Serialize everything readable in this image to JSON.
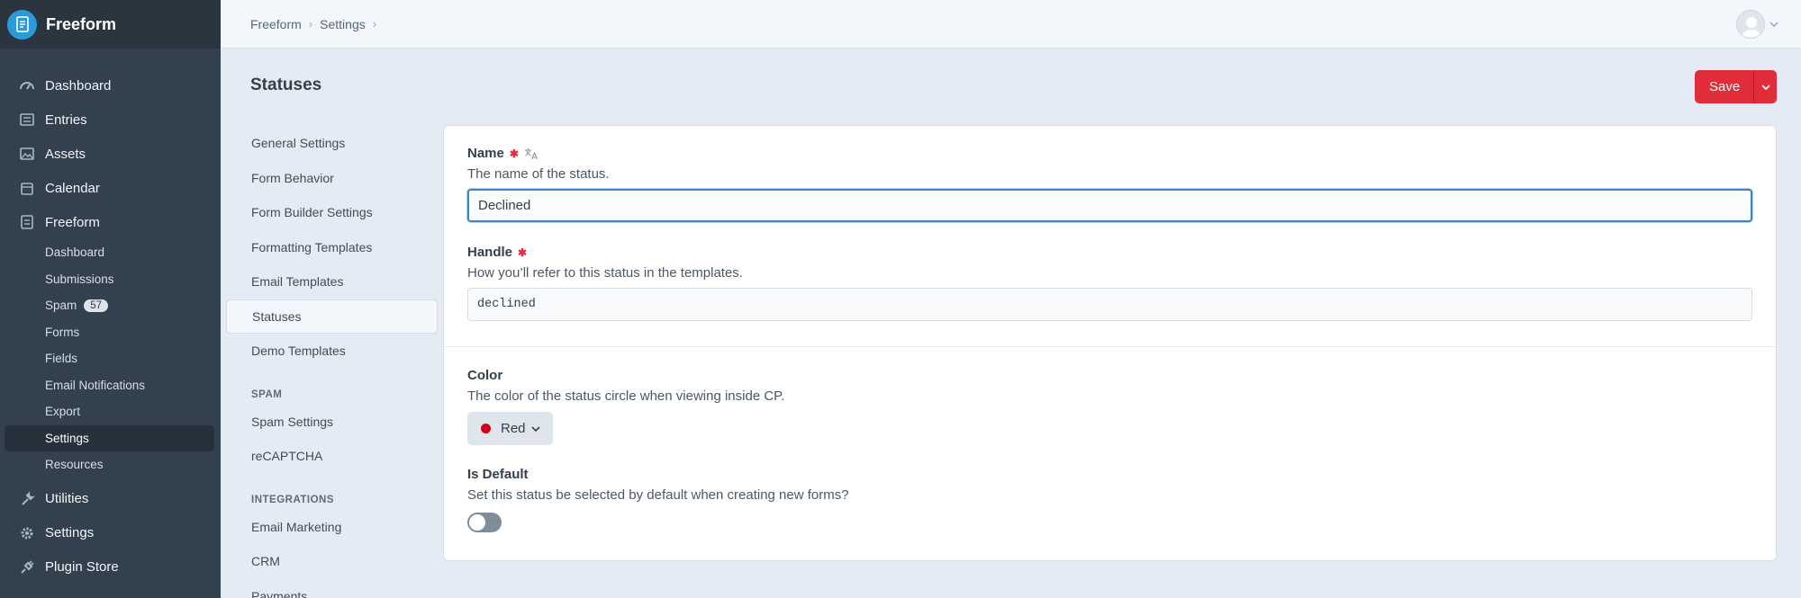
{
  "brand": {
    "name": "Freeform"
  },
  "sidebar": {
    "items": [
      {
        "label": "Dashboard",
        "icon": "dashboard-icon"
      },
      {
        "label": "Entries",
        "icon": "entries-icon"
      },
      {
        "label": "Assets",
        "icon": "assets-icon"
      },
      {
        "label": "Calendar",
        "icon": "calendar-icon"
      },
      {
        "label": "Freeform",
        "icon": "freeform-icon"
      }
    ],
    "sub_items": [
      {
        "label": "Dashboard"
      },
      {
        "label": "Submissions"
      },
      {
        "label": "Spam",
        "badge": "57"
      },
      {
        "label": "Forms"
      },
      {
        "label": "Fields"
      },
      {
        "label": "Email Notifications"
      },
      {
        "label": "Export"
      },
      {
        "label": "Settings",
        "active": true
      },
      {
        "label": "Resources"
      }
    ],
    "bottom_items": [
      {
        "label": "Utilities",
        "icon": "wrench-icon"
      },
      {
        "label": "Settings",
        "icon": "gear-icon"
      },
      {
        "label": "Plugin Store",
        "icon": "plug-icon"
      }
    ]
  },
  "header": {
    "breadcrumbs": [
      "Freeform",
      "Settings"
    ]
  },
  "page": {
    "title": "Statuses",
    "save_label": "Save"
  },
  "settings_nav": {
    "items": [
      "General Settings",
      "Form Behavior",
      "Form Builder Settings",
      "Formatting Templates",
      "Email Templates",
      "Statuses",
      "Demo Templates"
    ],
    "active": "Statuses",
    "spam_heading": "SPAM",
    "spam_items": [
      "Spam Settings",
      "reCAPTCHA"
    ],
    "integrations_heading": "INTEGRATIONS",
    "integration_items": [
      "Email Marketing",
      "CRM",
      "Payments"
    ]
  },
  "form": {
    "name": {
      "label": "Name",
      "instructions": "The name of the status.",
      "value": "Declined"
    },
    "handle": {
      "label": "Handle",
      "instructions": "How you’ll refer to this status in the templates.",
      "value": "declined"
    },
    "color": {
      "label": "Color",
      "instructions": "The color of the status circle when viewing inside CP.",
      "value": "Red",
      "swatch": "#d0021b"
    },
    "is_default": {
      "label": "Is Default",
      "instructions": "Set this status be selected by default when creating new forms?",
      "value": false
    }
  },
  "colors": {
    "accent": "#e12d39",
    "sidebar_bg": "#33404d",
    "focus": "#3e83c5"
  }
}
